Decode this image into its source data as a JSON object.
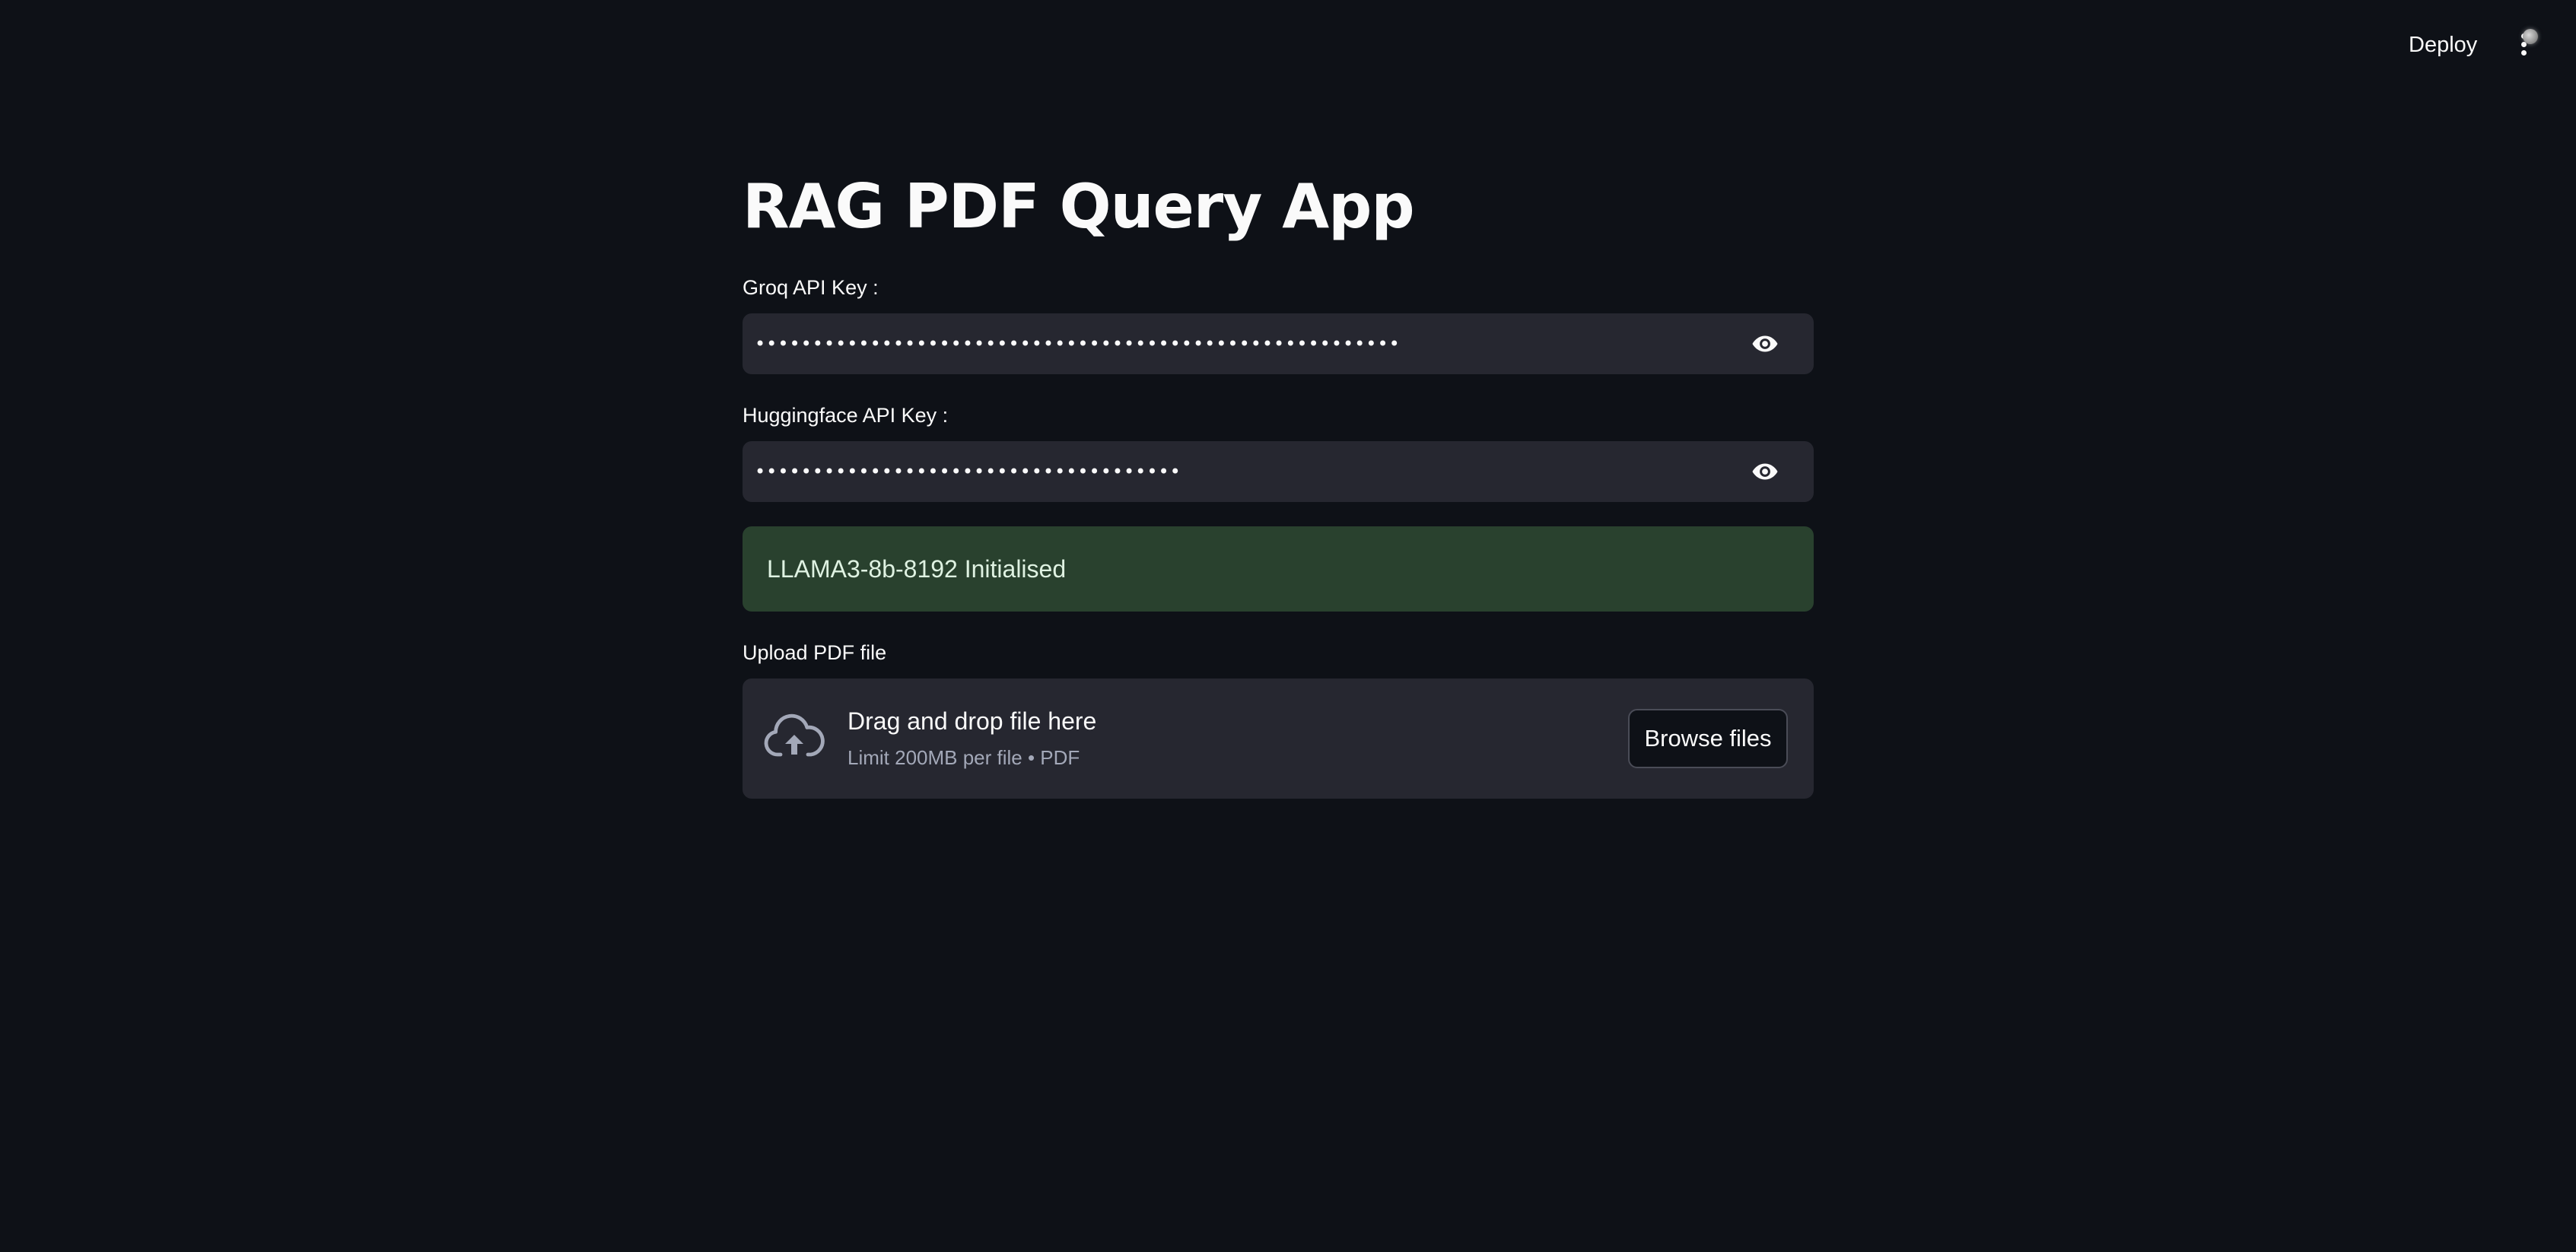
{
  "header": {
    "deploy_label": "Deploy",
    "menu_icon": "vertical-dots-icon",
    "status_icon": "running-status-icon"
  },
  "main": {
    "title": "RAG PDF Query App",
    "groq": {
      "label": "Groq API Key :",
      "value": "••••••••••••••••••••••••••••••••••••••••••••••••••••••••",
      "icon": "eye-icon"
    },
    "huggingface": {
      "label": "Huggingface API Key :",
      "value": "•••••••••••••••••••••••••••••••••••••",
      "icon": "eye-icon"
    },
    "status_message": "LLAMA3-8b-8192 Initialised",
    "upload": {
      "label": "Upload PDF file",
      "drop_title": "Drag and drop file here",
      "drop_subtitle": "Limit 200MB per file • PDF",
      "browse_label": "Browse files",
      "icon": "cloud-upload-icon"
    }
  },
  "colors": {
    "background": "#0e1117",
    "input_background": "#262730",
    "success_background": "#29412e",
    "text": "#fafafa",
    "muted_text": "#a3a8b8"
  }
}
